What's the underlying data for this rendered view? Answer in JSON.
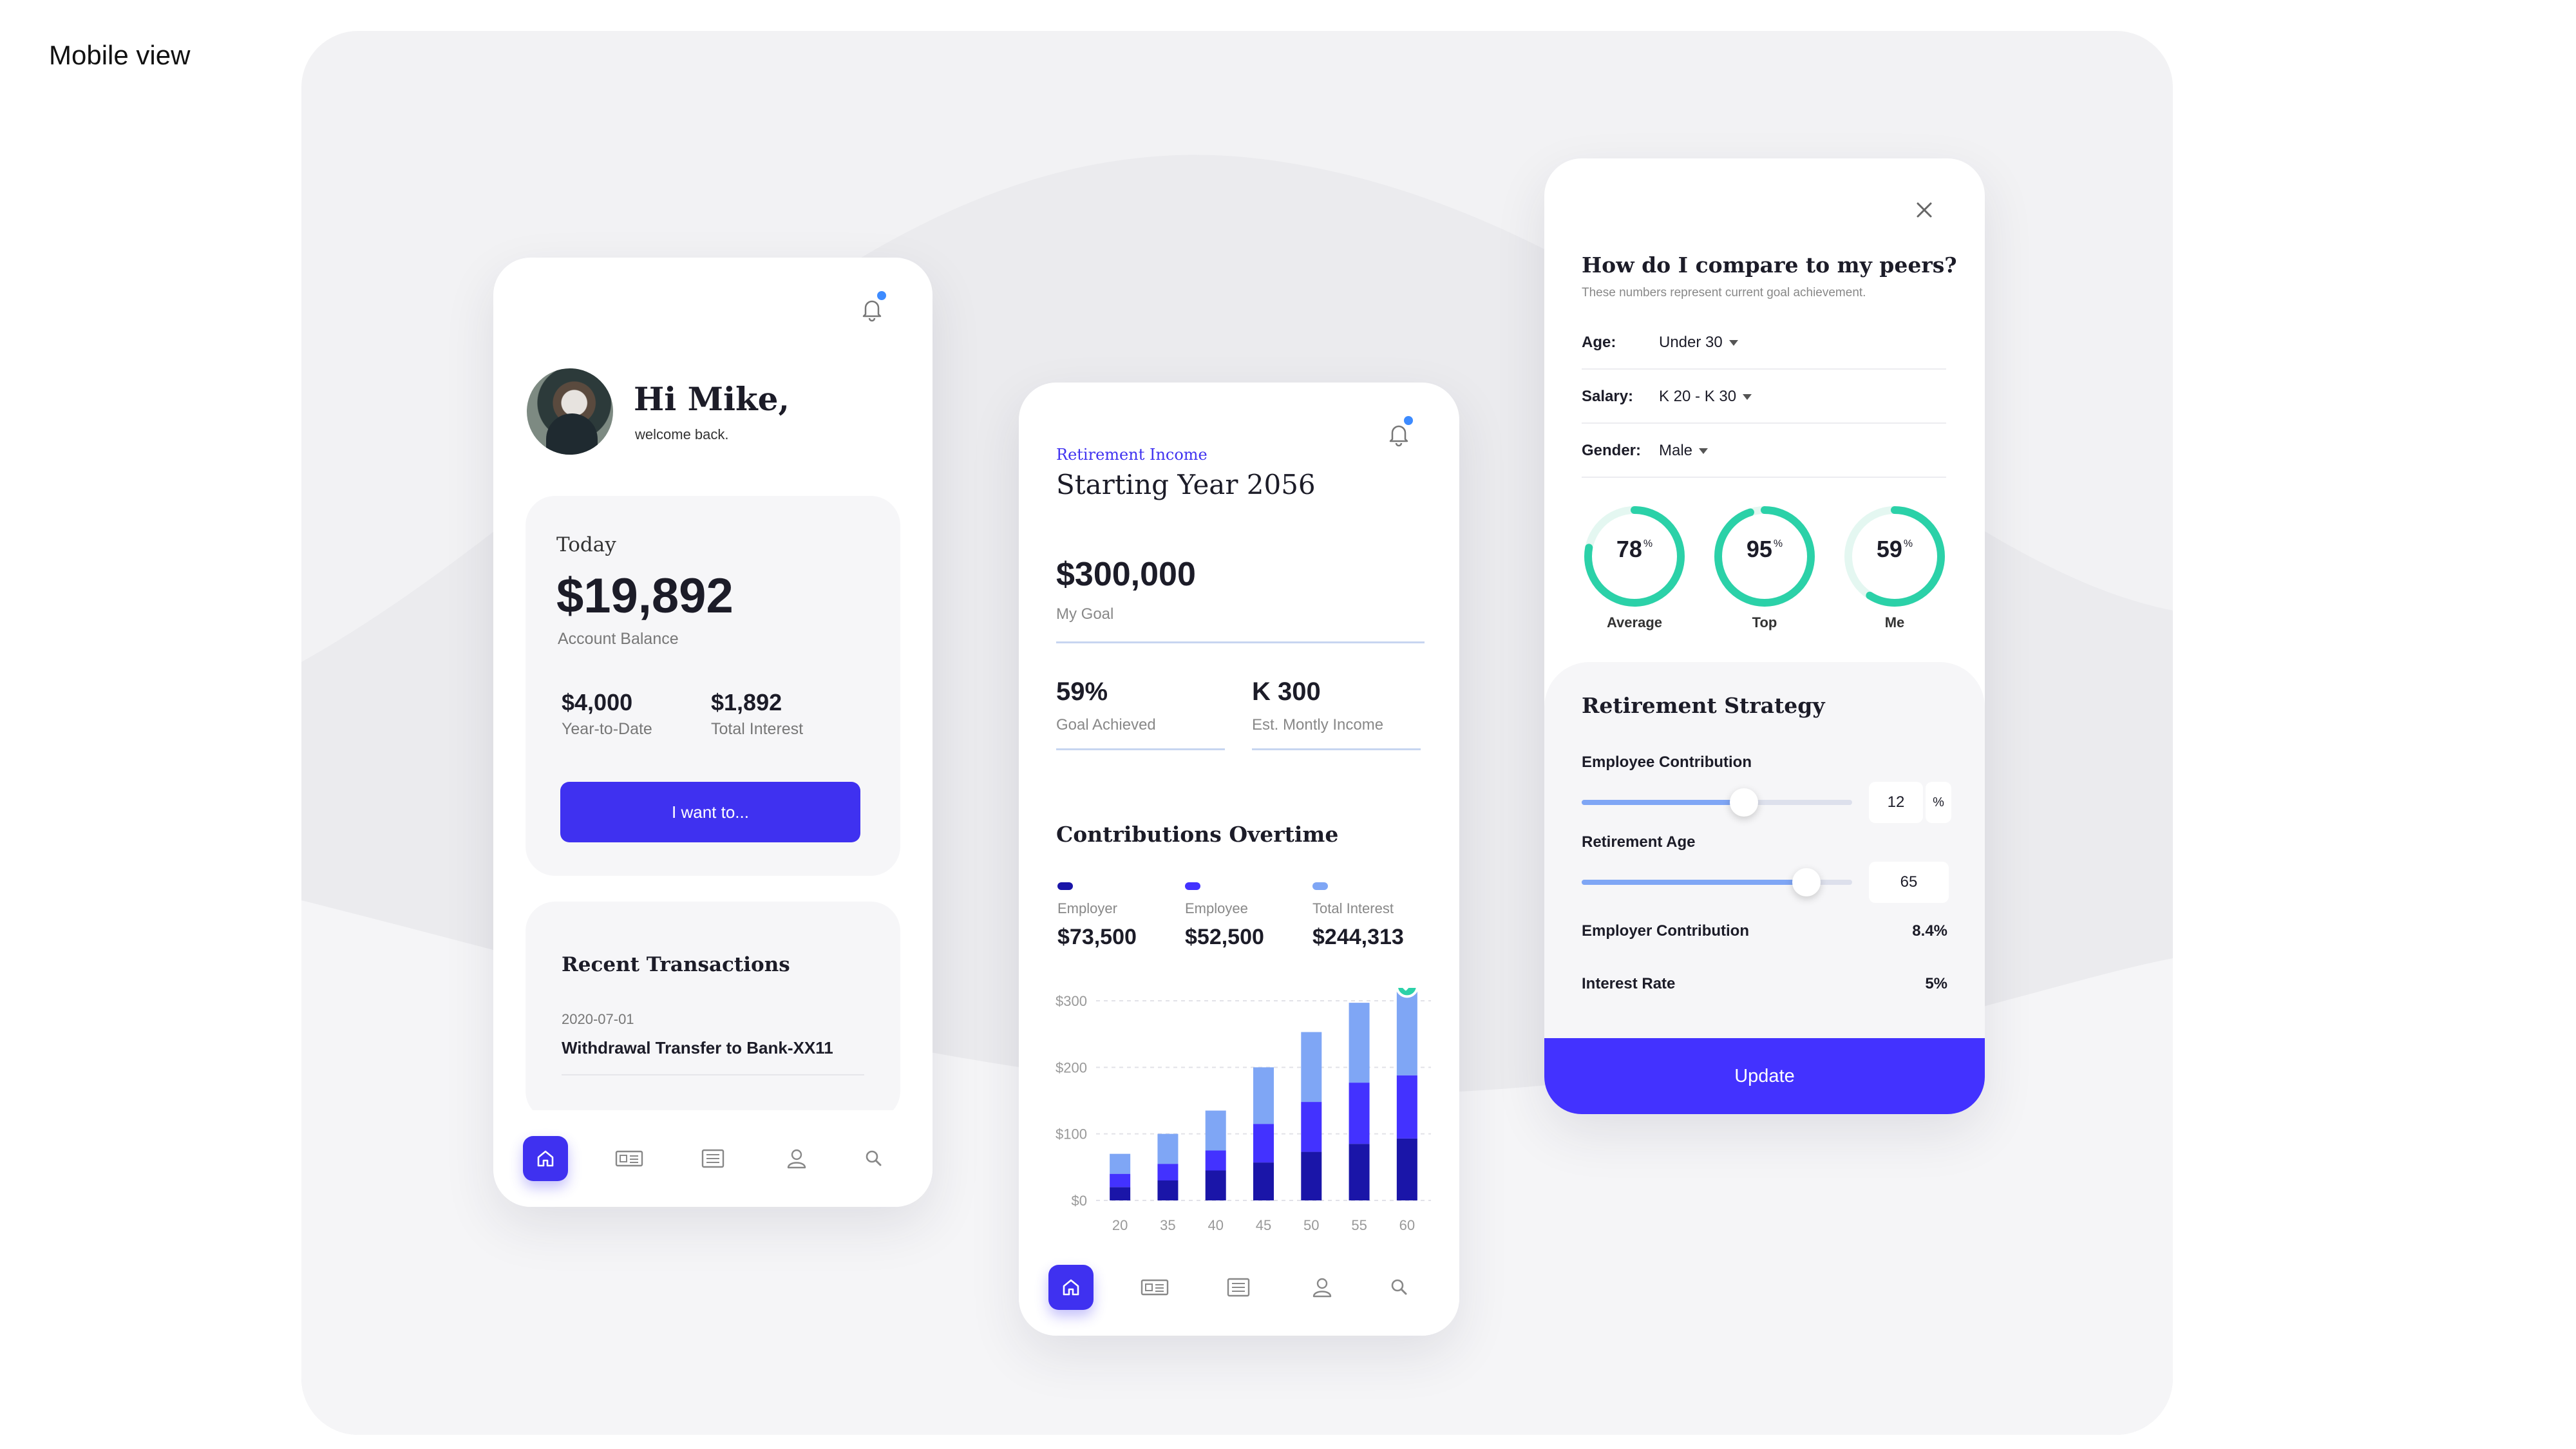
{
  "page_label": "Mobile view",
  "colors": {
    "accent": "#3f31f0",
    "teal": "#2bd1a8",
    "employer": "#1a15a8",
    "employee": "#4332ff",
    "interest": "#7fa6f5"
  },
  "card1": {
    "greeting": "Hi Mike,",
    "greeting_sub": "welcome back.",
    "today_label": "Today",
    "balance": "$19,892",
    "balance_label": "Account Balance",
    "ytd_value": "$4,000",
    "ytd_label": "Year-to-Date",
    "interest_value": "$1,892",
    "interest_label": "Total Interest",
    "primary_button": "I want to...",
    "recent_title": "Recent Transactions",
    "transactions": [
      {
        "date": "2020-07-01",
        "description": "Withdrawal Transfer to  Bank-XX11"
      }
    ],
    "tabs": [
      "home-icon",
      "card-icon",
      "list-icon",
      "profile-icon",
      "search-icon"
    ]
  },
  "card2": {
    "section_label": "Retirement Income",
    "title": "Starting Year 2056",
    "goal_value": "$300,000",
    "goal_label": "My Goal",
    "achieved_value": "59%",
    "achieved_label": "Goal Achieved",
    "income_value": "K 300",
    "income_label": "Est. Montly Income",
    "contrib_title": "Contributions Overtime",
    "legend": [
      {
        "label": "Employer",
        "value": "$73,500"
      },
      {
        "label": "Employee",
        "value": "$52,500"
      },
      {
        "label": "Total Interest",
        "value": "$244,313"
      }
    ]
  },
  "chart_data": {
    "type": "bar",
    "stacked": true,
    "categories": [
      "20",
      "35",
      "40",
      "45",
      "50",
      "55",
      "60"
    ],
    "series": [
      {
        "name": "Employer",
        "values": [
          20,
          30,
          45,
          57,
          73,
          85,
          93
        ]
      },
      {
        "name": "Employee",
        "values": [
          20,
          25,
          30,
          58,
          75,
          92,
          95
        ]
      },
      {
        "name": "Total Interest",
        "values": [
          30,
          45,
          60,
          85,
          105,
          120,
          132
        ]
      }
    ],
    "y_ticks": [
      "$0",
      "$100",
      "$200",
      "$300"
    ],
    "ylim": [
      0,
      300
    ],
    "grid": true
  },
  "card3": {
    "title": "How do I compare to my peers?",
    "subtitle": "These numbers represent current goal achievement.",
    "filters": [
      {
        "label": "Age:",
        "value": "Under 30"
      },
      {
        "label": "Salary:",
        "value": "K 20 - K 30"
      },
      {
        "label": "Gender:",
        "value": "Male"
      }
    ],
    "gauges": [
      {
        "label": "Average",
        "value": "78",
        "unit": "%",
        "pct": 78
      },
      {
        "label": "Top",
        "value": "95",
        "unit": "%",
        "pct": 95
      },
      {
        "label": "Me",
        "value": "59",
        "unit": "%",
        "pct": 59
      }
    ],
    "strategy_title": "Retirement Strategy",
    "employee_contribution_label": "Employee Contribution",
    "employee_contribution_value": "12",
    "employee_contribution_unit": "%",
    "employee_contribution_level": 0.6,
    "retirement_age_label": "Retirement Age",
    "retirement_age_value": "65",
    "retirement_age_level": 0.83,
    "employer_contribution_label": "Employer Contribution",
    "employer_contribution_value": "8.4%",
    "interest_rate_label": "Interest Rate",
    "interest_rate_value": "5%",
    "update_button": "Update"
  }
}
